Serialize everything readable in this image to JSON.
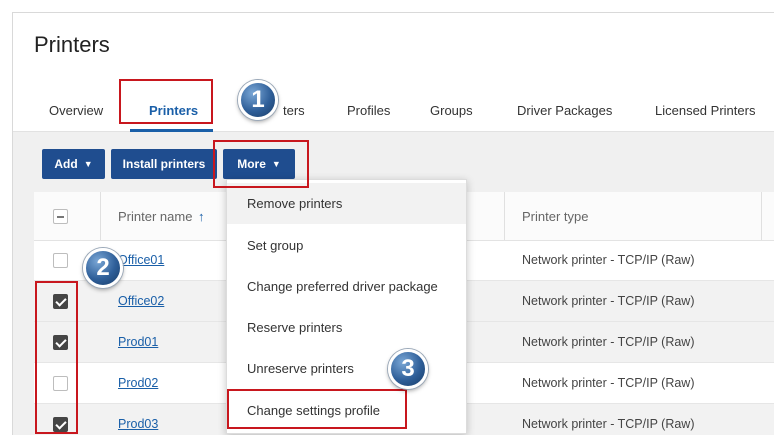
{
  "page": {
    "title": "Printers"
  },
  "tabs": [
    {
      "label": "Overview"
    },
    {
      "label": "Printers"
    },
    {
      "label": "ters"
    },
    {
      "label": "Profiles"
    },
    {
      "label": "Groups"
    },
    {
      "label": "Driver Packages"
    },
    {
      "label": "Licensed Printers"
    }
  ],
  "toolbar": {
    "add_label": "Add",
    "install_label": "Install printers",
    "more_label": "More",
    "caret": "▼"
  },
  "table": {
    "headers": {
      "name": "Printer name",
      "sort_arrow": "↑",
      "type": "Printer type"
    },
    "rows": [
      {
        "name": "Office01",
        "type": "Network printer - TCP/IP (Raw)",
        "checked": false
      },
      {
        "name": "Office02",
        "type": "Network printer - TCP/IP (Raw)",
        "checked": true
      },
      {
        "name": "Prod01",
        "type": "Network printer - TCP/IP (Raw)",
        "checked": true
      },
      {
        "name": "Prod02",
        "type": "Network printer - TCP/IP (Raw)",
        "checked": false
      },
      {
        "name": "Prod03",
        "type": "Network printer - TCP/IP (Raw)",
        "checked": true
      }
    ]
  },
  "menu": {
    "items": [
      {
        "label": "Remove printers"
      },
      {
        "label": "Set group"
      },
      {
        "label": "Change preferred driver package"
      },
      {
        "label": "Reserve printers"
      },
      {
        "label": "Unreserve printers"
      },
      {
        "label": "Change settings profile"
      }
    ]
  },
  "callouts": [
    {
      "number": "1"
    },
    {
      "number": "2"
    },
    {
      "number": "3"
    }
  ],
  "colors": {
    "accent": "#1a5fa8",
    "button": "#1f4d8f",
    "highlight": "#c8171e"
  }
}
